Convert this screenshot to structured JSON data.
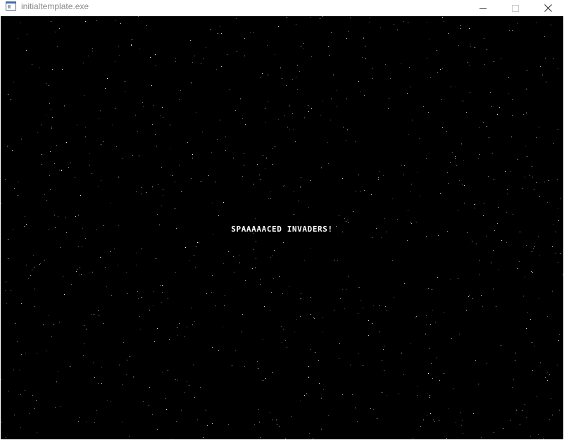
{
  "window": {
    "title": "initialtemplate.exe",
    "icon": "app-window-icon",
    "controls": {
      "minimize_icon": "minimize-icon",
      "maximize_icon": "maximize-icon",
      "close_icon": "close-icon"
    }
  },
  "game": {
    "title_text": "SPAAAAACED INVADERS!",
    "background_color": "#000000",
    "star_color": "#ffffff",
    "text_color": "#ffffff"
  }
}
